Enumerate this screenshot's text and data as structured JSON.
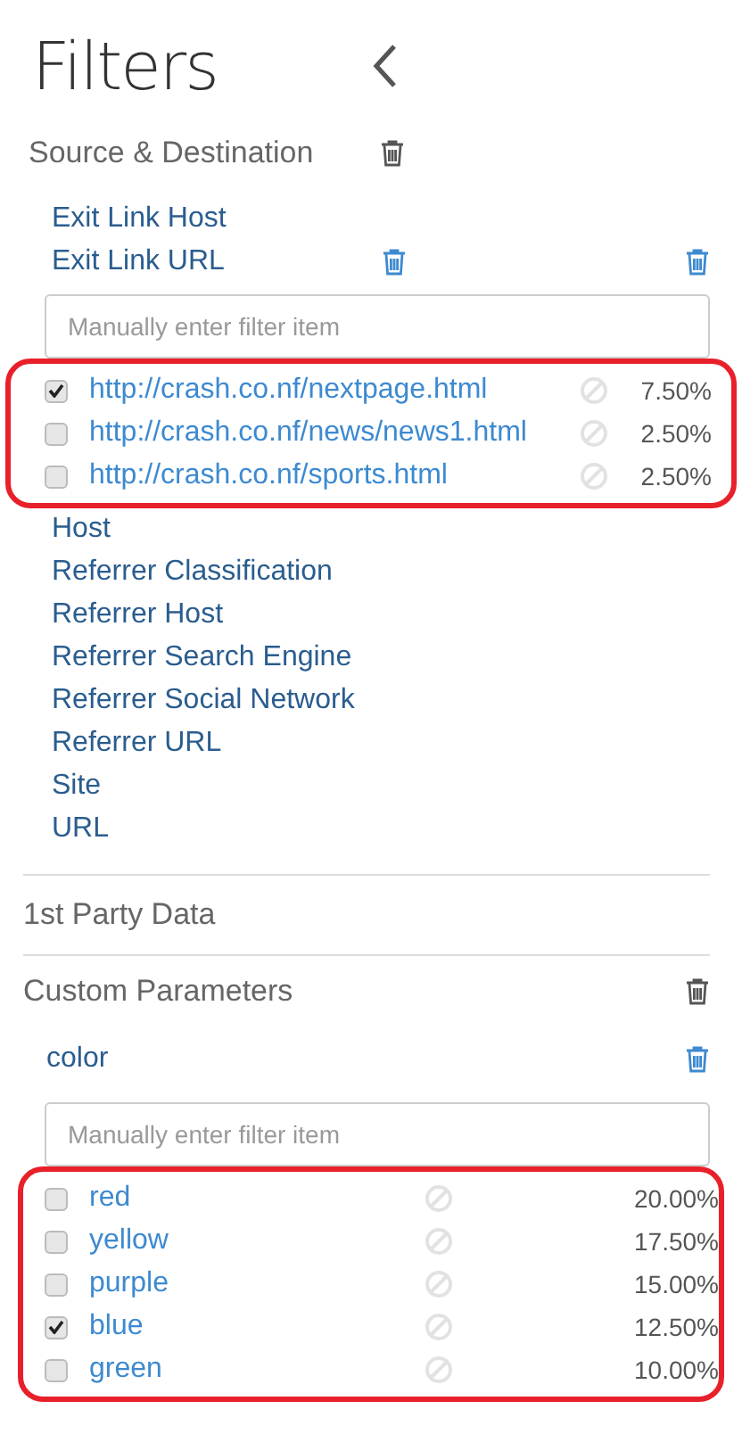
{
  "title": "Filters",
  "sections": [
    {
      "kind": "group",
      "heading": "Source & Destination",
      "fields": [
        {
          "label": "Exit Link Host"
        },
        {
          "label": "Exit Link URL",
          "inline_delete": true,
          "placeholder": "Manually enter filter item",
          "annotated": true,
          "values": [
            {
              "label": "http://crash.co.nf/nextpage.html",
              "checked": true,
              "share": "7.50%"
            },
            {
              "label": "http://crash.co.nf/news/news1.html",
              "checked": false,
              "share": "2.50%"
            },
            {
              "label": "http://crash.co.nf/sports.html",
              "checked": false,
              "share": "2.50%"
            }
          ]
        },
        {
          "label": "Host"
        },
        {
          "label": "Referrer Classification"
        },
        {
          "label": "Referrer Host"
        },
        {
          "label": "Referrer Search Engine"
        },
        {
          "label": "Referrer Social Network"
        },
        {
          "label": "Referrer URL"
        },
        {
          "label": "Site"
        },
        {
          "label": "URL"
        }
      ]
    },
    {
      "kind": "collapsed",
      "heading": "1st Party Data"
    },
    {
      "kind": "custom",
      "heading": "Custom Parameters",
      "fields": [
        {
          "label": "color",
          "placeholder": "Manually enter filter item",
          "annotated": true,
          "values": [
            {
              "label": "red",
              "checked": false,
              "share": "20.00%"
            },
            {
              "label": "yellow",
              "checked": false,
              "share": "17.50%"
            },
            {
              "label": "purple",
              "checked": false,
              "share": "15.00%"
            },
            {
              "label": "blue",
              "checked": true,
              "share": "12.50%"
            },
            {
              "label": "green",
              "checked": false,
              "share": "10.00%"
            }
          ]
        }
      ]
    }
  ]
}
